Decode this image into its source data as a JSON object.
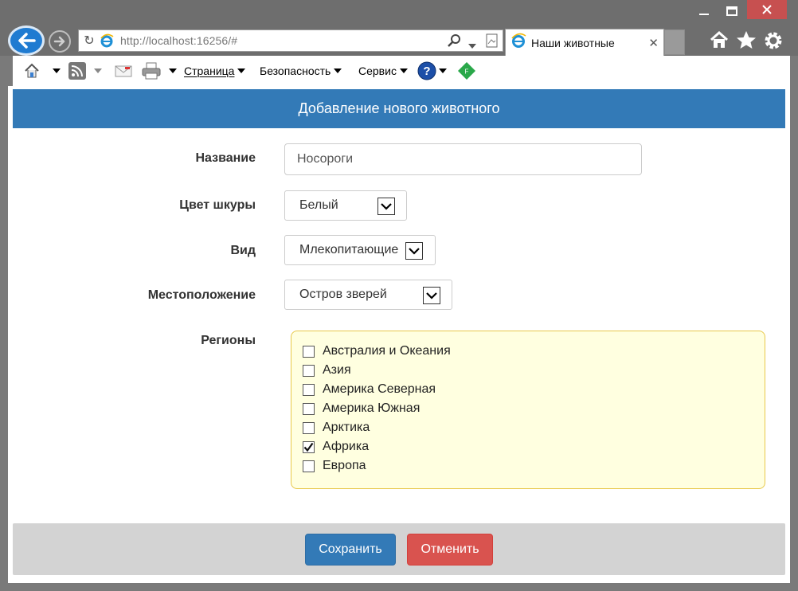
{
  "browser": {
    "url_host": "http://localhost",
    "url_rest": ":16256/#",
    "tab_title": "Наши животные",
    "tab_close": "✕"
  },
  "command_bar": {
    "page": "Страница",
    "security": "Безопасность",
    "service": "Сервис"
  },
  "form": {
    "header": "Добавление нового животного",
    "name_label": "Название",
    "name_value": "Носороги",
    "skin_label": "Цвет шкуры",
    "skin_value": "Белый",
    "kind_label": "Вид",
    "kind_value": "Млекопитающие",
    "location_label": "Местоположение",
    "location_value": "Остров зверей",
    "regions_label": "Регионы",
    "regions": [
      {
        "label": "Австралия и Океания",
        "checked": false
      },
      {
        "label": "Азия",
        "checked": false
      },
      {
        "label": "Америка Северная",
        "checked": false
      },
      {
        "label": "Америка Южная",
        "checked": false
      },
      {
        "label": "Арктика",
        "checked": false
      },
      {
        "label": "Африка",
        "checked": true
      },
      {
        "label": "Европа",
        "checked": false
      }
    ],
    "save_label": "Сохранить",
    "cancel_label": "Отменить"
  },
  "colors": {
    "primary": "#337ab7",
    "danger": "#d9534f",
    "regions_bg": "#ffffe0",
    "regions_border": "#e8c84a"
  },
  "icons": [
    "back-arrow-icon",
    "forward-arrow-icon",
    "reload-icon",
    "ie-logo-icon",
    "search-icon",
    "compat-view-icon",
    "home-icon",
    "favorites-star-icon",
    "gear-icon",
    "rss-icon",
    "mail-icon",
    "print-icon",
    "help-icon",
    "feed-diamond-icon"
  ]
}
